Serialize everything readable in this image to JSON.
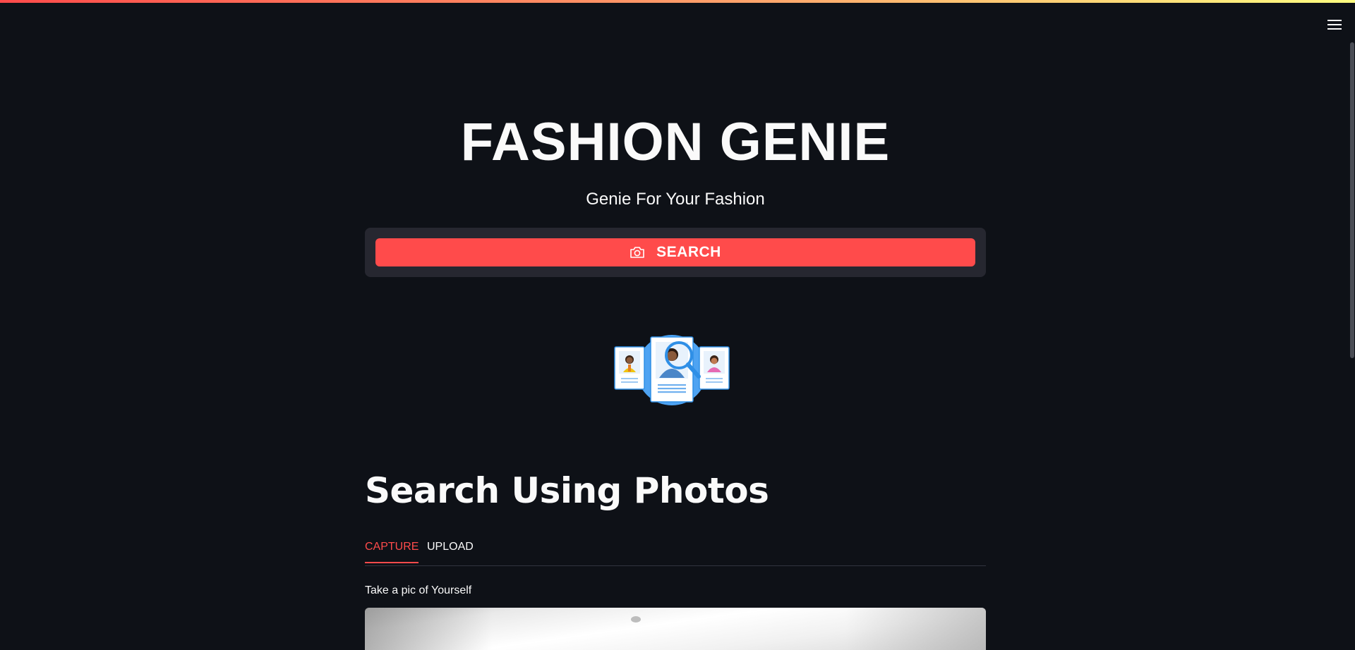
{
  "app": {
    "title": "FASHION GENIE",
    "subtitle": "Genie For Your Fashion",
    "menu_icon": "hamburger-menu-icon"
  },
  "search": {
    "button_label": "SEARCH",
    "button_icon": "camera-icon"
  },
  "illustration": {
    "icon": "profile-search-illustration"
  },
  "photo_search": {
    "heading": "Search Using Photos",
    "tabs": [
      {
        "label": "CAPTURE",
        "active": true
      },
      {
        "label": "UPLOAD",
        "active": false
      }
    ],
    "capture_label": "Take a pic of Yourself"
  },
  "colors": {
    "background": "#0e1117",
    "accent": "#ff4b4b",
    "panel": "#262730",
    "text": "#fafafa"
  }
}
